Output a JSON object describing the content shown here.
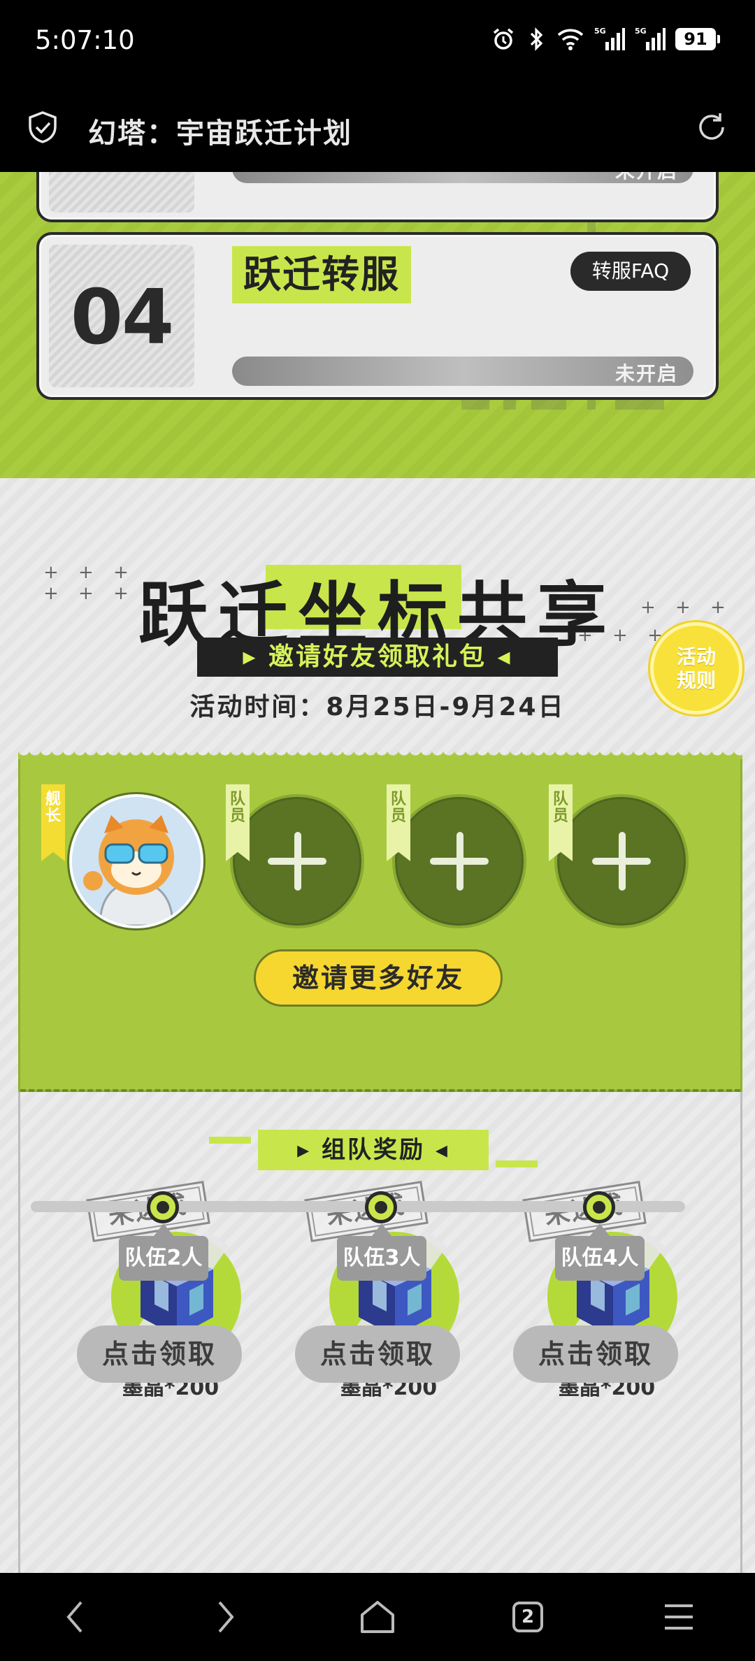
{
  "status_bar": {
    "time": "5:07:10",
    "battery": "91",
    "network_label_1": "5G",
    "network_label_2": "5G"
  },
  "title_bar": {
    "title": "幻塔：宇宙跃迁计划",
    "left_icon": "shield-check-icon",
    "right_icon": "refresh-icon"
  },
  "steps": {
    "prev": {
      "status": "未开启"
    },
    "current": {
      "number": "04",
      "title": "跃迁转服",
      "faq_label": "转服FAQ",
      "status": "未开启"
    }
  },
  "share": {
    "title_parts": [
      "跃迁",
      "坐标",
      "共享"
    ],
    "subtitle": "▸ 邀请好友领取礼包 ◂",
    "activity_time": "活动时间：8月25日-9月24日",
    "rules_line1": "活动",
    "rules_line2": "规则"
  },
  "team": {
    "members": [
      {
        "role": "舰长",
        "filled": true
      },
      {
        "role": "队员",
        "filled": false
      },
      {
        "role": "队员",
        "filled": false
      },
      {
        "role": "队员",
        "filled": false
      }
    ],
    "invite_label": "邀请更多好友"
  },
  "rewards": {
    "header": "▸ 组队奖励 ◂",
    "items": [
      {
        "stamp": "未达成",
        "name": "墨晶*200",
        "team_size": "队伍2人",
        "claim": "点击领取"
      },
      {
        "stamp": "未达成",
        "name": "墨晶*200",
        "team_size": "队伍3人",
        "claim": "点击领取"
      },
      {
        "stamp": "未达成",
        "name": "墨晶*200",
        "team_size": "队伍4人",
        "claim": "点击领取"
      }
    ]
  },
  "bottom_nav": {
    "tab_count": "2",
    "items": [
      "back-icon",
      "forward-icon",
      "home-icon",
      "tabs-icon",
      "menu-icon"
    ]
  },
  "colors": {
    "accent_green": "#c8e64c",
    "panel_green": "#a8c93f",
    "button_yellow": "#f6d730",
    "dark": "#2a2a2a"
  }
}
